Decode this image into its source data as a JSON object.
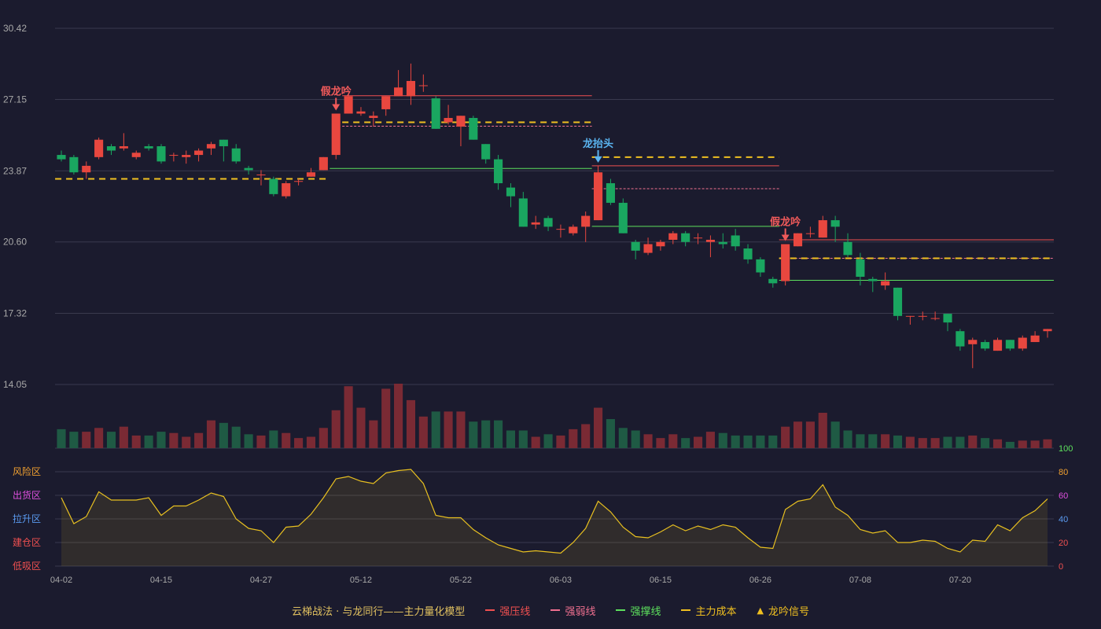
{
  "chart_data": {
    "type": "candlestick",
    "price_axis": {
      "ticks": [
        30.42,
        27.15,
        23.87,
        20.6,
        17.32,
        14.05
      ],
      "min": 14.05,
      "max": 30.42
    },
    "x_tick_labels": [
      {
        "i": 0,
        "label": "04-02"
      },
      {
        "i": 8,
        "label": "04-15"
      },
      {
        "i": 16,
        "label": "04-27"
      },
      {
        "i": 24,
        "label": "05-12"
      },
      {
        "i": 32,
        "label": "05-22"
      },
      {
        "i": 40,
        "label": "06-03"
      },
      {
        "i": 48,
        "label": "06-15"
      },
      {
        "i": 56,
        "label": "06-26"
      },
      {
        "i": 64,
        "label": "07-08"
      },
      {
        "i": 72,
        "label": "07-20"
      }
    ],
    "candles": [
      [
        24.6,
        24.4,
        24.8,
        24.3
      ],
      [
        24.5,
        23.8,
        24.6,
        23.7
      ],
      [
        23.8,
        24.1,
        24.3,
        23.5
      ],
      [
        24.5,
        25.3,
        25.4,
        24.4
      ],
      [
        25.0,
        24.8,
        25.1,
        24.6
      ],
      [
        24.9,
        25.0,
        25.6,
        24.8
      ],
      [
        24.5,
        24.7,
        24.8,
        24.4
      ],
      [
        25.0,
        24.9,
        25.1,
        24.8
      ],
      [
        25.0,
        24.3,
        25.1,
        24.2
      ],
      [
        24.6,
        24.6,
        24.7,
        24.3
      ],
      [
        24.5,
        24.6,
        24.8,
        24.2
      ],
      [
        24.6,
        24.8,
        24.9,
        24.3
      ],
      [
        24.9,
        25.1,
        25.2,
        24.6
      ],
      [
        25.3,
        25.0,
        25.3,
        24.3
      ],
      [
        24.9,
        24.3,
        25.1,
        24.2
      ],
      [
        24.0,
        23.9,
        24.1,
        23.7
      ],
      [
        23.7,
        23.7,
        23.9,
        23.2
      ],
      [
        23.5,
        22.8,
        23.6,
        22.7
      ],
      [
        22.7,
        23.3,
        23.4,
        22.6
      ],
      [
        23.4,
        23.4,
        23.5,
        23.2
      ],
      [
        23.6,
        23.8,
        24.0,
        23.6
      ],
      [
        23.9,
        24.5,
        24.5,
        23.9
      ],
      [
        24.6,
        26.5,
        26.5,
        24.4
      ],
      [
        26.5,
        27.3,
        27.4,
        26.5
      ],
      [
        26.5,
        26.6,
        26.8,
        26.4
      ],
      [
        26.3,
        26.4,
        26.6,
        25.9
      ],
      [
        26.7,
        27.3,
        27.3,
        26.4
      ],
      [
        27.3,
        27.7,
        28.5,
        27.3
      ],
      [
        27.3,
        28.0,
        28.8,
        26.9
      ],
      [
        27.8,
        27.8,
        28.3,
        27.5
      ],
      [
        27.2,
        25.8,
        27.3,
        25.8
      ],
      [
        26.1,
        26.3,
        26.9,
        26.0
      ],
      [
        25.9,
        26.4,
        26.4,
        25.0
      ],
      [
        26.3,
        25.3,
        26.4,
        25.3
      ],
      [
        25.1,
        24.4,
        25.1,
        24.2
      ],
      [
        24.4,
        23.3,
        24.6,
        23.0
      ],
      [
        23.1,
        22.7,
        23.3,
        22.2
      ],
      [
        22.6,
        21.3,
        22.9,
        21.3
      ],
      [
        21.4,
        21.5,
        21.8,
        21.2
      ],
      [
        21.7,
        21.3,
        21.8,
        21.1
      ],
      [
        21.2,
        21.2,
        21.4,
        20.8
      ],
      [
        21.0,
        21.3,
        21.4,
        20.9
      ],
      [
        21.3,
        21.8,
        22.0,
        20.6
      ],
      [
        21.6,
        23.8,
        24.1,
        21.6
      ],
      [
        23.3,
        22.4,
        23.5,
        22.3
      ],
      [
        22.4,
        21.0,
        22.6,
        21.0
      ],
      [
        20.6,
        20.2,
        20.7,
        19.8
      ],
      [
        20.1,
        20.5,
        20.8,
        20.0
      ],
      [
        20.4,
        20.6,
        20.7,
        20.2
      ],
      [
        20.7,
        21.0,
        21.1,
        20.5
      ],
      [
        21.0,
        20.6,
        21.1,
        20.4
      ],
      [
        20.8,
        20.8,
        21.0,
        20.5
      ],
      [
        20.6,
        20.7,
        20.9,
        19.9
      ],
      [
        20.6,
        20.5,
        21.0,
        20.3
      ],
      [
        20.9,
        20.4,
        21.2,
        20.2
      ],
      [
        20.3,
        19.8,
        20.5,
        19.6
      ],
      [
        19.8,
        19.2,
        19.9,
        19.0
      ],
      [
        18.9,
        18.7,
        19.0,
        18.5
      ],
      [
        18.8,
        20.5,
        20.5,
        18.6
      ],
      [
        20.4,
        21.0,
        21.0,
        20.4
      ],
      [
        21.0,
        21.0,
        21.3,
        20.8
      ],
      [
        20.8,
        21.6,
        21.8,
        20.8
      ],
      [
        21.6,
        21.3,
        21.8,
        20.6
      ],
      [
        20.6,
        20.0,
        21.0,
        19.9
      ],
      [
        19.8,
        19.0,
        20.1,
        18.6
      ],
      [
        18.9,
        18.8,
        19.0,
        18.3
      ],
      [
        18.6,
        18.8,
        19.2,
        18.4
      ],
      [
        18.5,
        17.2,
        18.5,
        17.0
      ],
      [
        17.2,
        17.2,
        17.2,
        16.8
      ],
      [
        17.2,
        17.2,
        17.4,
        17.0
      ],
      [
        17.1,
        17.1,
        17.4,
        17.0
      ],
      [
        17.3,
        16.9,
        17.3,
        16.5
      ],
      [
        16.5,
        15.8,
        16.6,
        15.6
      ],
      [
        15.9,
        16.1,
        16.2,
        14.8
      ],
      [
        16.0,
        15.7,
        16.1,
        15.6
      ],
      [
        15.6,
        16.1,
        16.2,
        15.6
      ],
      [
        16.1,
        15.7,
        16.1,
        15.6
      ],
      [
        15.7,
        16.2,
        16.3,
        15.6
      ],
      [
        16.0,
        16.3,
        16.5,
        16.0
      ],
      [
        16.5,
        16.6,
        16.6,
        16.2
      ]
    ],
    "volume": [
      15,
      13,
      13,
      16,
      13,
      17,
      10,
      10,
      13,
      12,
      9,
      12,
      22,
      20,
      17,
      11,
      10,
      14,
      12,
      8,
      9,
      16,
      30,
      49,
      32,
      22,
      47,
      51,
      38,
      25,
      29,
      29,
      29,
      21,
      22,
      22,
      14,
      14,
      9,
      11,
      10,
      15,
      19,
      32,
      23,
      16,
      14,
      11,
      8,
      11,
      8,
      9,
      13,
      12,
      10,
      10,
      10,
      10,
      17,
      21,
      21,
      28,
      21,
      14,
      11,
      11,
      11,
      10,
      9,
      8,
      8,
      9,
      9,
      10,
      8,
      7,
      5,
      6,
      6,
      7
    ],
    "oscillator": {
      "axis_ticks": [
        100,
        80,
        60,
        40,
        20,
        0
      ],
      "zones": [
        "风险区",
        "出货区",
        "拉升区",
        "建仓区",
        "低吸区"
      ],
      "values": [
        58,
        36,
        42,
        63,
        56,
        56,
        56,
        58,
        43,
        51,
        51,
        56,
        62,
        59,
        40,
        32,
        30,
        20,
        33,
        34,
        44,
        58,
        74,
        76,
        72,
        70,
        79,
        81,
        82,
        70,
        43,
        41,
        41,
        31,
        24,
        18,
        15,
        12,
        13,
        12,
        11,
        20,
        32,
        55,
        46,
        33,
        25,
        24,
        29,
        35,
        30,
        34,
        31,
        35,
        33,
        24,
        16,
        15,
        48,
        55,
        57,
        69,
        50,
        43,
        31,
        28,
        30,
        20,
        20,
        22,
        21,
        15,
        12,
        22,
        21,
        35,
        30,
        41,
        47,
        57
      ]
    },
    "annotations": [
      {
        "i": 22,
        "text": "假龙吟",
        "color": "#f05a5a"
      },
      {
        "i": 43,
        "text": "龙抬头",
        "color": "#5ab4f0"
      },
      {
        "i": 58,
        "text": "假龙吟",
        "color": "#f05a5a"
      }
    ],
    "levels": [
      {
        "kind": "strong_resist",
        "from": 23,
        "to": 42,
        "price": 27.32
      },
      {
        "kind": "weak",
        "from": 23,
        "to": 42,
        "price": 25.92
      },
      {
        "kind": "support",
        "from": 22,
        "to": 42,
        "price": 23.98
      },
      {
        "kind": "cost",
        "from": 23,
        "to": 42,
        "price": 26.1
      },
      {
        "kind": "cost",
        "from": 0,
        "to": 21,
        "price": 23.5
      },
      {
        "kind": "strong_resist",
        "from": 43,
        "to": 57,
        "price": 24.1
      },
      {
        "kind": "weak",
        "from": 43,
        "to": 57,
        "price": 23.05
      },
      {
        "kind": "support",
        "from": 43,
        "to": 57,
        "price": 21.32
      },
      {
        "kind": "cost",
        "from": 43,
        "to": 57,
        "price": 24.5
      },
      {
        "kind": "strong_resist",
        "from": 58,
        "to": 79,
        "price": 20.7
      },
      {
        "kind": "weak",
        "from": 58,
        "to": 79,
        "price": 19.85
      },
      {
        "kind": "support",
        "from": 58,
        "to": 79,
        "price": 18.84
      },
      {
        "kind": "cost",
        "from": 58,
        "to": 79,
        "price": 19.85
      }
    ],
    "colors": {
      "up": "#e8473f",
      "down": "#1aa660",
      "up_volume": "#7a2a34",
      "down_volume": "#1f5a44",
      "strong_resist": "#f05050",
      "weak": "#f07090",
      "support": "#5de05d",
      "cost": "#f0c020",
      "osc_line": "#e8c020",
      "zone_colors": [
        "#f0a030",
        "#e050e0",
        "#5a9af0",
        "#f05050",
        "#f05050"
      ],
      "grid": "#3a3a4e",
      "axis_text": "#a8a8a8"
    }
  },
  "legend": {
    "title": "云梯战法 · 与龙同行——主力量化模型",
    "items": [
      {
        "label": "强压线",
        "color": "#f05050",
        "style": "solid"
      },
      {
        "label": "强弱线",
        "color": "#f07090",
        "style": "dashed"
      },
      {
        "label": "强撑线",
        "color": "#5de05d",
        "style": "solid"
      },
      {
        "label": "主力成本",
        "color": "#f0c020",
        "style": "dashed"
      },
      {
        "label": "龙吟信号",
        "color": "#f0c020",
        "style": "triangle"
      }
    ]
  }
}
